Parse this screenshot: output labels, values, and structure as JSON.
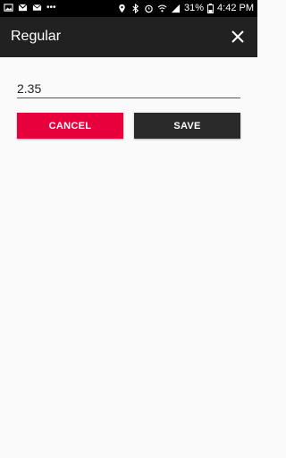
{
  "status_bar": {
    "battery": "31%",
    "time": "4:42 PM"
  },
  "toolbar": {
    "title": "Regular"
  },
  "form": {
    "value": "2.35"
  },
  "actions": {
    "cancel_label": "CANCEL",
    "save_label": "SAVE"
  },
  "colors": {
    "cancel_bg": "#e8003d",
    "save_bg": "#2a2a2a",
    "toolbar_bg": "#212121"
  }
}
